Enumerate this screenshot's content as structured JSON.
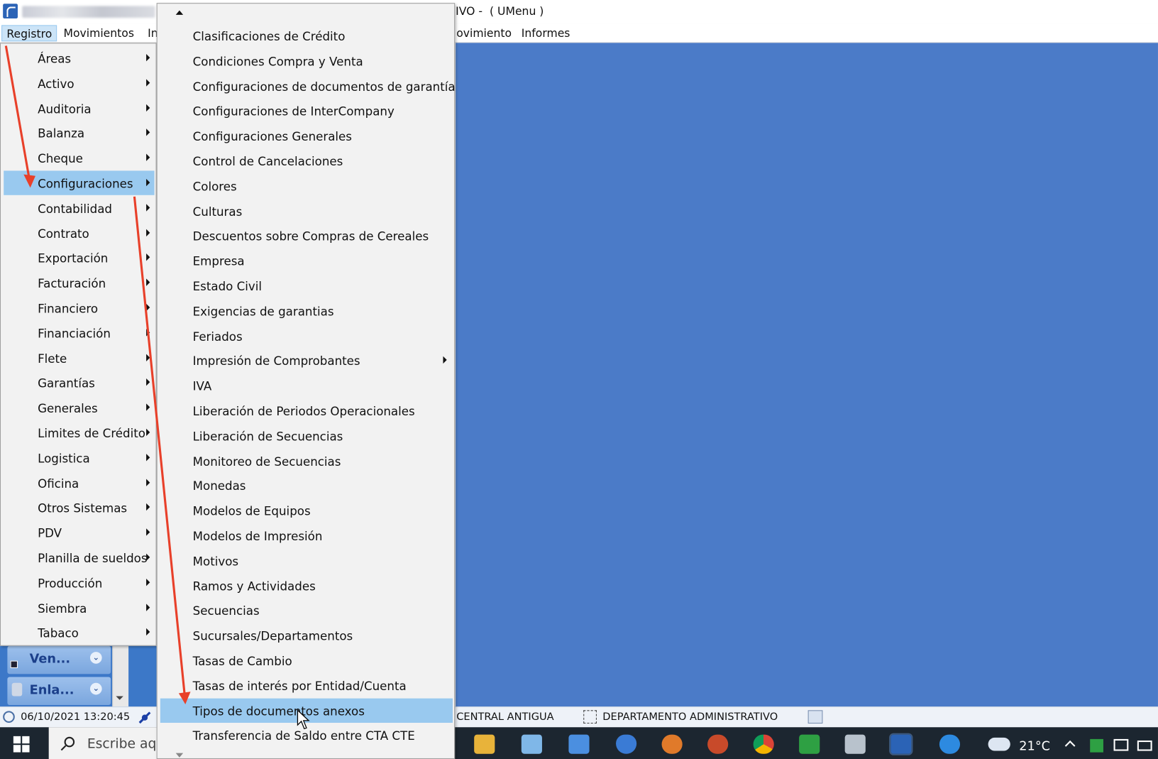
{
  "window": {
    "title_suffix": "IVO -  ( UMenu )",
    "menubar": [
      "Registro",
      "Movimientos",
      "In",
      "ovimiento",
      "Informes"
    ]
  },
  "menu_level1": [
    "Áreas",
    "Activo",
    "Auditoria",
    "Balanza",
    "Cheque",
    "Configuraciones",
    "Contabilidad",
    "Contrato",
    "Exportación",
    "Facturación",
    "Financiero",
    "Financiación",
    "Flete",
    "Garantías",
    "Generales",
    "Limites de Crédito",
    "Logistica",
    "Oficina",
    "Otros Sistemas",
    "PDV",
    "Planilla de sueldos",
    "Producción",
    "Siembra",
    "Tabaco"
  ],
  "menu_level1_selected": "Configuraciones",
  "menu_level2": [
    "Clasificaciones de Crédito",
    "Condiciones Compra y Venta",
    "Configuraciones de documentos de garantía",
    "Configuraciones de InterCompany",
    "Configuraciones Generales",
    "Control de Cancelaciones",
    "Colores",
    "Culturas",
    "Descuentos sobre Compras de Cereales",
    "Empresa",
    "Estado Civil",
    "Exigencias de garantias",
    "Feriados",
    "Impresión de Comprobantes",
    "IVA",
    "Liberación de Periodos Operacionales",
    "Liberación de Secuencias",
    "Monitoreo de Secuencias",
    "Monedas",
    "Modelos de Equipos",
    "Modelos de Impresión",
    "Motivos",
    "Ramos y Actividades",
    "Secuencias",
    "Sucursales/Departamentos",
    "Tasas de Cambio",
    "Tasas de interés por Entidad/Cuenta",
    "Tipos de documentos anexos",
    "Transferencia de Saldo entre CTA CTE"
  ],
  "menu_level2_submenu_item": "Impresión de Comprobantes",
  "menu_level2_selected": "Tipos de documentos anexos",
  "left_panel": {
    "buttons": [
      "Ven...",
      "Enla..."
    ]
  },
  "statusbar": {
    "datetime": "06/10/2021 13:20:45",
    "location": "CENTRAL ANTIGUA",
    "department": "DEPARTAMENTO ADMINISTRATIVO"
  },
  "taskbar": {
    "search_placeholder": "Escribe aq",
    "temperature": "21°C"
  },
  "colors": {
    "desktop": "#4b7bc8",
    "menu_bg": "#f2f2f2",
    "selection": "#99c9ef",
    "annotation_arrow": "#e8402a",
    "taskbar": "#1c2630"
  }
}
